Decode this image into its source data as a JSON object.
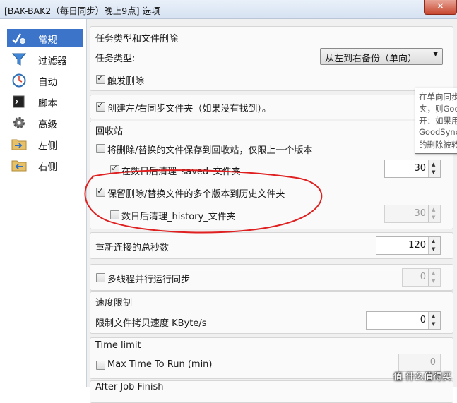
{
  "window": {
    "title": "[BAK-BAK2（每日同步）晚上9点] 选项",
    "close_glyph": "✕"
  },
  "sidebar": {
    "items": [
      {
        "label": "常规",
        "icon": "check-gear-icon",
        "active": true
      },
      {
        "label": "过滤器",
        "icon": "funnel-icon"
      },
      {
        "label": "自动",
        "icon": "clock-icon"
      },
      {
        "label": "脚本",
        "icon": "console-icon"
      },
      {
        "label": "高级",
        "icon": "gear-icon"
      },
      {
        "label": "左侧",
        "icon": "folder-arrow-right-icon"
      },
      {
        "label": "右侧",
        "icon": "folder-arrow-left-icon"
      }
    ]
  },
  "task": {
    "group_title": "任务类型和文件删除",
    "type_label": "任务类型:",
    "type_value": "从左到右备份（单向）",
    "trigger_delete_label": "触发删除"
  },
  "create_folders": {
    "label": "创建左/右同步文件夹（如果没有找到）。"
  },
  "recycle": {
    "group_title": "回收站",
    "save_label": "将删除/替换的文件保存到回收站，仅限上一个版本",
    "cleanup_label": "在数日后清理_saved_文件夹",
    "cleanup_value": "30"
  },
  "history": {
    "keep_label": "保留删除/替换文件的多个版本到历史文件夹",
    "cleanup_label": "数日后清理_history_文件夹",
    "cleanup_value": "30"
  },
  "reconnect": {
    "label": "重新连接的总秒数",
    "value": "120"
  },
  "multithread": {
    "label": "多线程并行运行同步",
    "value": "0"
  },
  "speed": {
    "group_title": "速度限制",
    "label": "限制文件拷贝速度 KByte/s",
    "value": "0"
  },
  "timelimit": {
    "group_title": "Time limit",
    "label": "Max Time To Run (min)",
    "value": "0"
  },
  "afterjob": {
    "group_title": "After Job Finish"
  },
  "tooltip": {
    "lines": [
      "在单向同步任",
      "夹，则Goo",
      "开：如果用",
      "GoodSync",
      "的删除被转"
    ]
  },
  "watermark": {
    "text": "值 什么值得买"
  },
  "colors": {
    "sidebar_active": "#3b74c9",
    "annotation_red": "#e02020"
  }
}
